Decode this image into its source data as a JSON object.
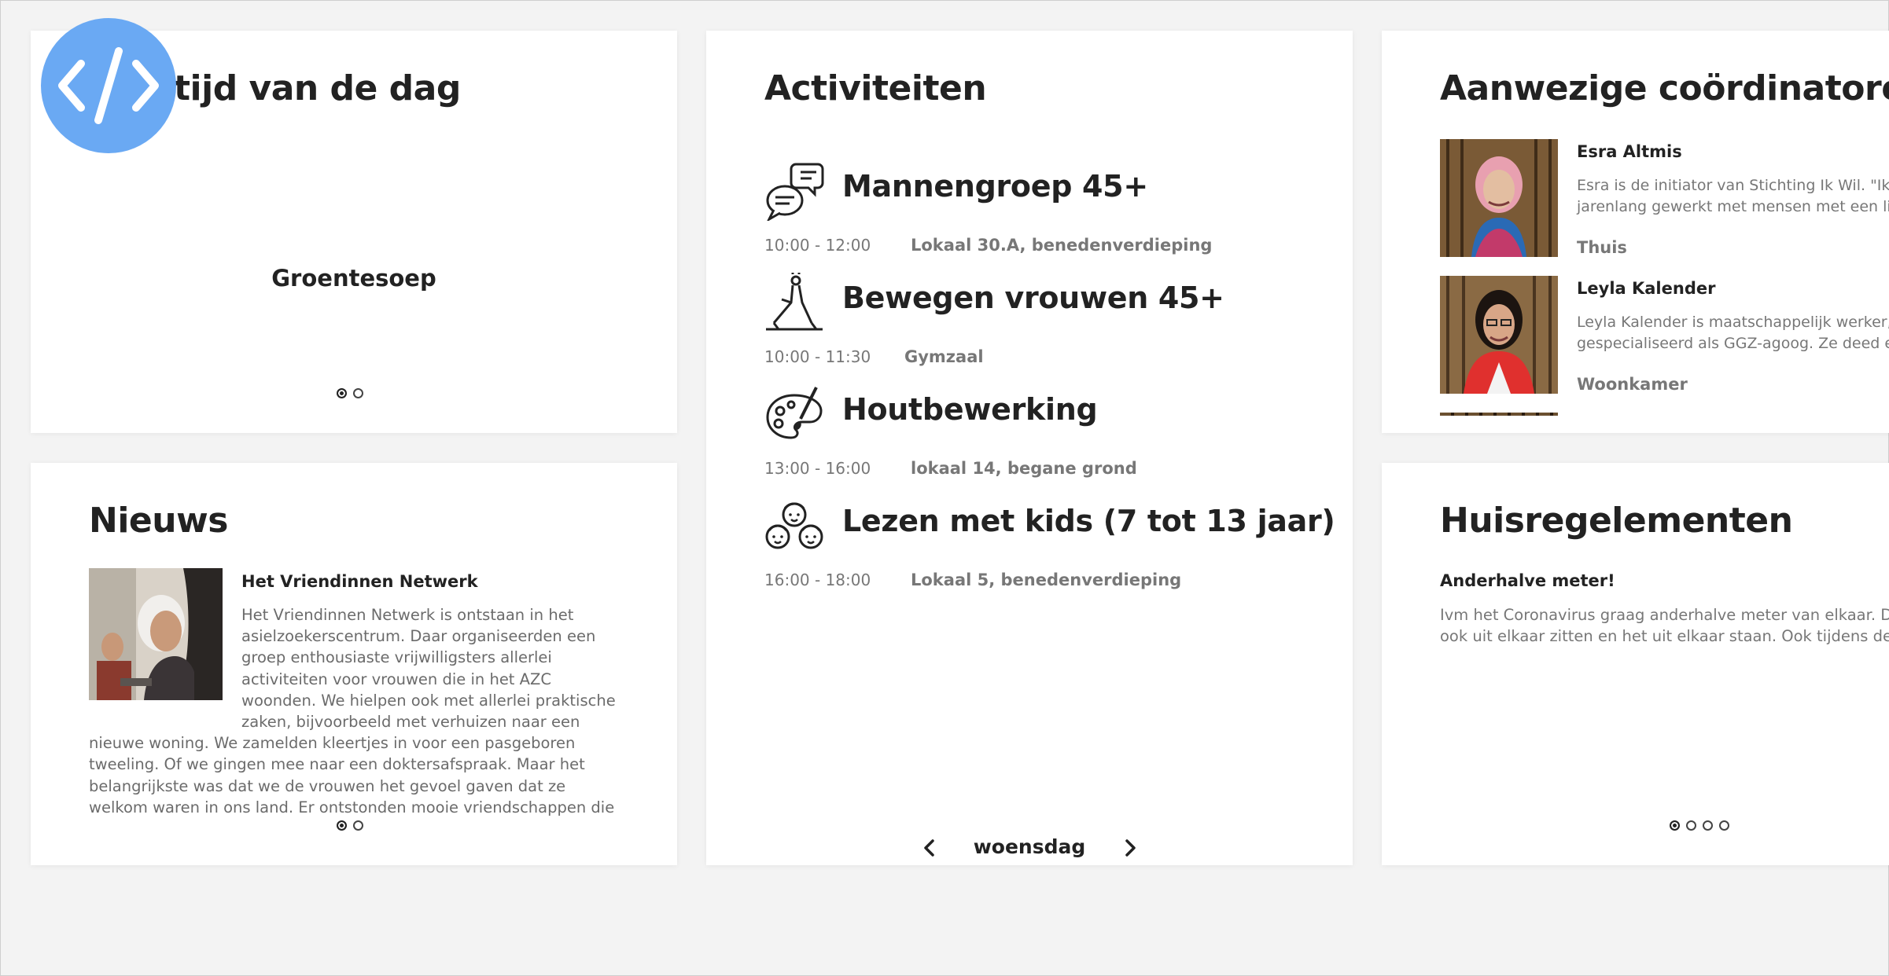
{
  "meal": {
    "title": "tijd van de dag",
    "dish": "Groentesoep"
  },
  "activities": {
    "title": "Activiteiten",
    "items": [
      {
        "icon": "speech-bubbles-icon",
        "title": "Mannengroep 45+",
        "time": "10:00 - 12:00",
        "location": "Lokaal 30.A, benedenverdieping"
      },
      {
        "icon": "yoga-person-icon",
        "title": "Bewegen vrouwen 45+",
        "time": "10:00 - 11:30",
        "location": "Gymzaal"
      },
      {
        "icon": "paint-palette-icon",
        "title": "Houtbewerking",
        "time": "13:00 - 16:00",
        "location": "lokaal 14, begane grond"
      },
      {
        "icon": "kids-faces-icon",
        "title": "Lezen met kids (7 tot 13 jaar)",
        "time": "16:00 - 18:00",
        "location": "Lokaal 5, benedenverdieping"
      }
    ],
    "day": "woensdag"
  },
  "coordinators": {
    "title": "Aanwezige coördinatoren",
    "items": [
      {
        "name": "Esra Altmis",
        "desc_1": "Esra is de initiator van Stichting Ik Wil. \"Ik heb",
        "desc_2": "jarenlang gewerkt met mensen met een lich",
        "room": "Thuis"
      },
      {
        "name": "Leyla Kalender",
        "desc_1": "Leyla Kalender is maatschappelijk werker,",
        "desc_2": "gespecialiseerd als GGZ-agoog. Ze deed er",
        "room": "Woonkamer"
      }
    ]
  },
  "news": {
    "title": "Nieuws",
    "item_title": "Het Vriendinnen Netwerk",
    "item_body": "Het Vriendinnen Netwerk is ontstaan in het asielzoekerscentrum. Daar organiseerden een groep enthousiaste vrijwilligsters allerlei activiteiten voor vrouwen die in het AZC woonden. We hielpen ook met allerlei praktische zaken, bijvoorbeeld met verhuizen naar een nieuwe woning. We zamelden kleertjes in voor een pasgeboren tweeling. Of we gingen mee naar een doktersafspraak. Maar het belangrijkste was dat we de vrouwen het gevoel gaven dat ze welkom waren in ons land. Er ontstonden mooie vriendschappen die"
  },
  "rules": {
    "title": "Huisregelementen",
    "item_title": "Anderhalve meter!",
    "line_1": "Ivm het Coronavirus graag anderhalve meter van elkaar. Dat",
    "line_2": "ook uit elkaar zitten en het uit elkaar staan. Ook tijdens de acti"
  },
  "colors": {
    "logo_bg": "#6aa9f3",
    "background": "#f3f3f3",
    "text": "#222222",
    "muted": "#777777"
  }
}
